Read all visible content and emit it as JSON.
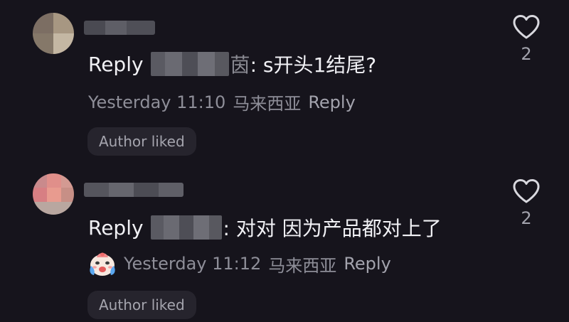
{
  "comments": [
    {
      "reply_prefix": "Reply",
      "mention_tail": "茵",
      "text": ": s开头1结尾?",
      "time": "Yesterday 11:10",
      "region": "马来西亚",
      "reply_label": "Reply",
      "badge": "Author liked",
      "likes": "2",
      "heart_icon": "heart-outline-icon"
    },
    {
      "reply_prefix": "Reply",
      "mention_tail": "",
      "text": ": 对对 因为产品都对上了",
      "time": "Yesterday 11:12",
      "region": "马来西亚",
      "reply_label": "Reply",
      "badge": "Author liked",
      "likes": "2",
      "heart_icon": "heart-outline-icon",
      "emoji": "crying-face-emoji"
    }
  ],
  "colors": {
    "background": "#16141c",
    "primary_text": "#f1f1f5",
    "secondary_text": "#8e8e98",
    "badge_bg": "#26242d"
  }
}
